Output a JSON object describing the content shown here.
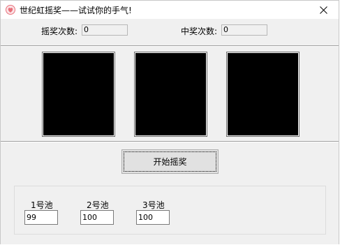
{
  "window": {
    "title": "世纪虹摇奖——试试你的手气!",
    "icon": "heart-icon",
    "close_icon": "close-icon"
  },
  "counters": {
    "spin_label": "摇奖次数:",
    "spin_value": "0",
    "win_label": "中奖次数:",
    "win_value": "0"
  },
  "reels": [
    {
      "color": "#000000"
    },
    {
      "color": "#000000"
    },
    {
      "color": "#000000"
    }
  ],
  "start_button": {
    "label": "开始摇奖"
  },
  "pools": [
    {
      "label": "1号池",
      "value": "99"
    },
    {
      "label": "2号池",
      "value": "100"
    },
    {
      "label": "3号池",
      "value": "100"
    }
  ],
  "colors": {
    "icon_pink": "#e8707a",
    "window_bg": "#f0f0f0"
  }
}
